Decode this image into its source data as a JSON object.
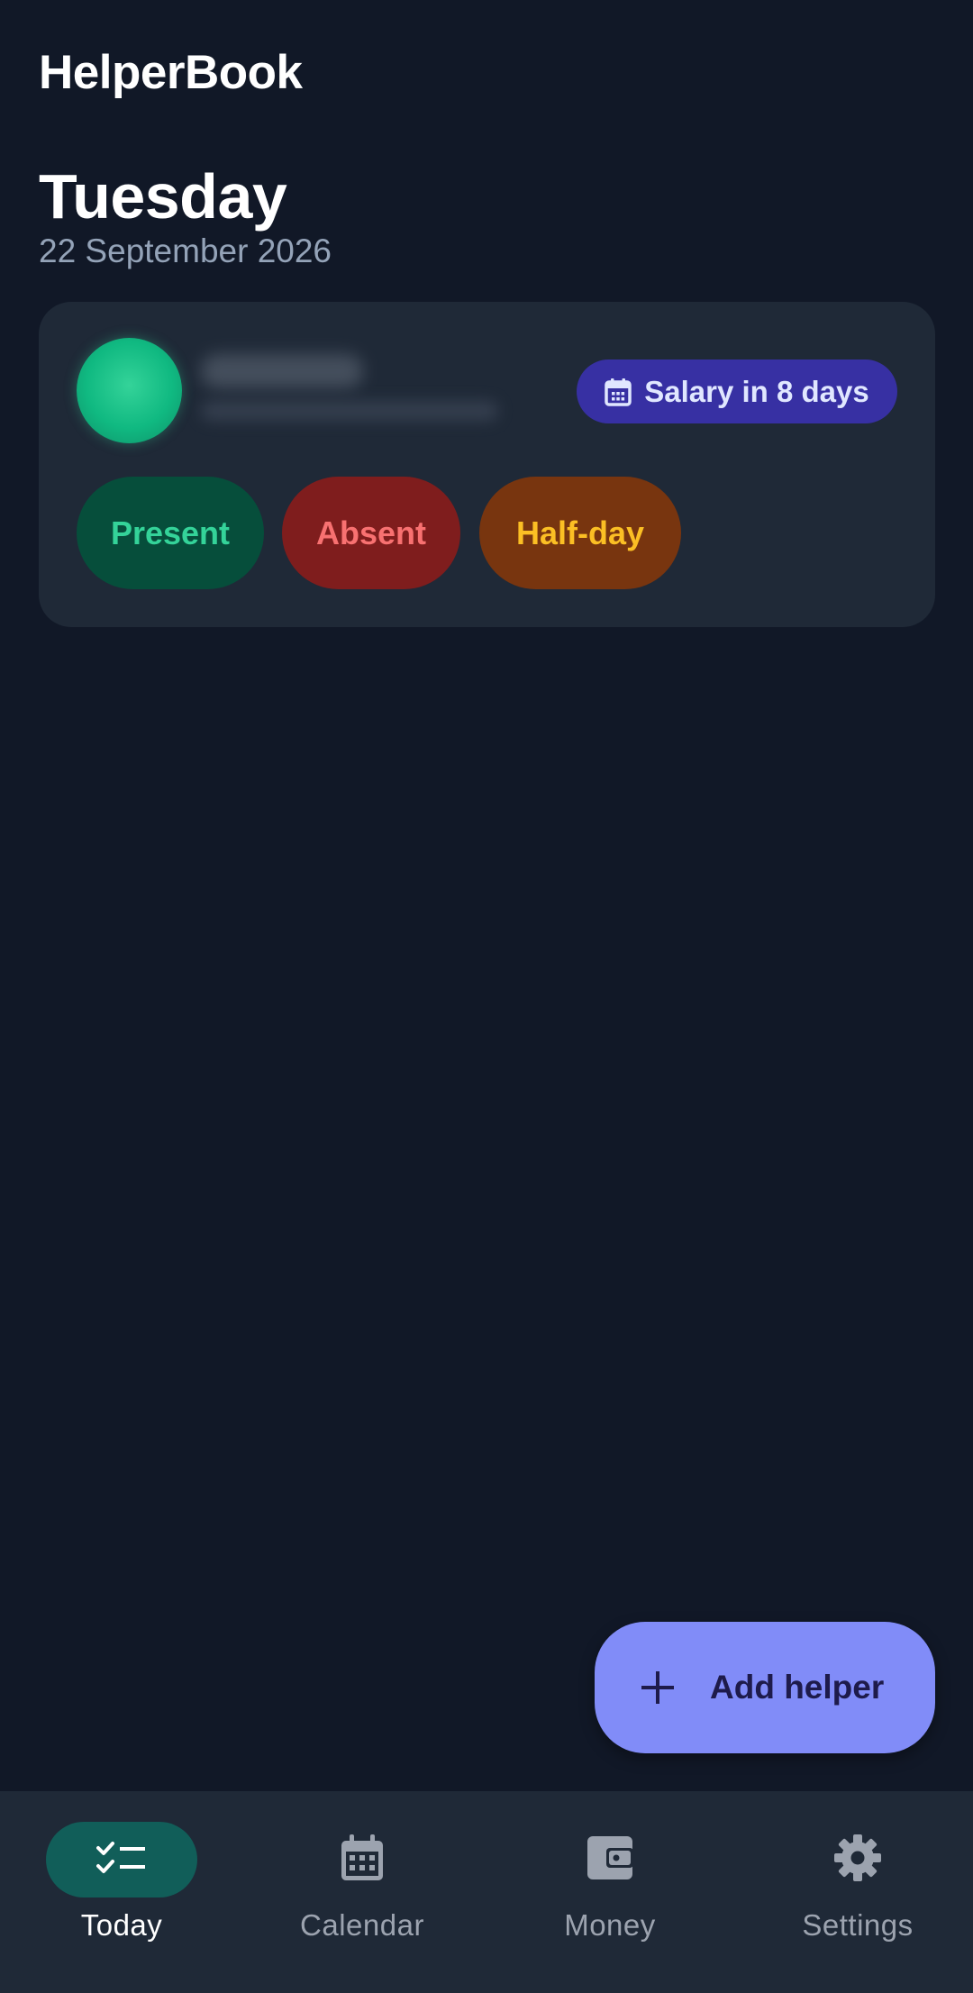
{
  "app": {
    "title": "HelperBook"
  },
  "header": {
    "day": "Tuesday",
    "date": "22 September 2026"
  },
  "helper_card": {
    "avatar_color": "#10b981",
    "salary_chip": {
      "icon": "calendar-icon",
      "label": "Salary in 8 days"
    },
    "status_buttons": {
      "present": "Present",
      "absent": "Absent",
      "halfday": "Half-day"
    }
  },
  "fab": {
    "icon": "plus-icon",
    "label": "Add helper"
  },
  "bottom_nav": {
    "items": [
      {
        "label": "Today",
        "icon": "checklist-icon",
        "active": true
      },
      {
        "label": "Calendar",
        "icon": "calendar-icon",
        "active": false
      },
      {
        "label": "Money",
        "icon": "wallet-icon",
        "active": false
      },
      {
        "label": "Settings",
        "icon": "gear-icon",
        "active": false
      }
    ]
  },
  "colors": {
    "background": "#111827",
    "card": "#1f2937",
    "accent": "#818cf8",
    "present": "#34d399",
    "absent": "#f87171",
    "halfday": "#fbbf24"
  }
}
